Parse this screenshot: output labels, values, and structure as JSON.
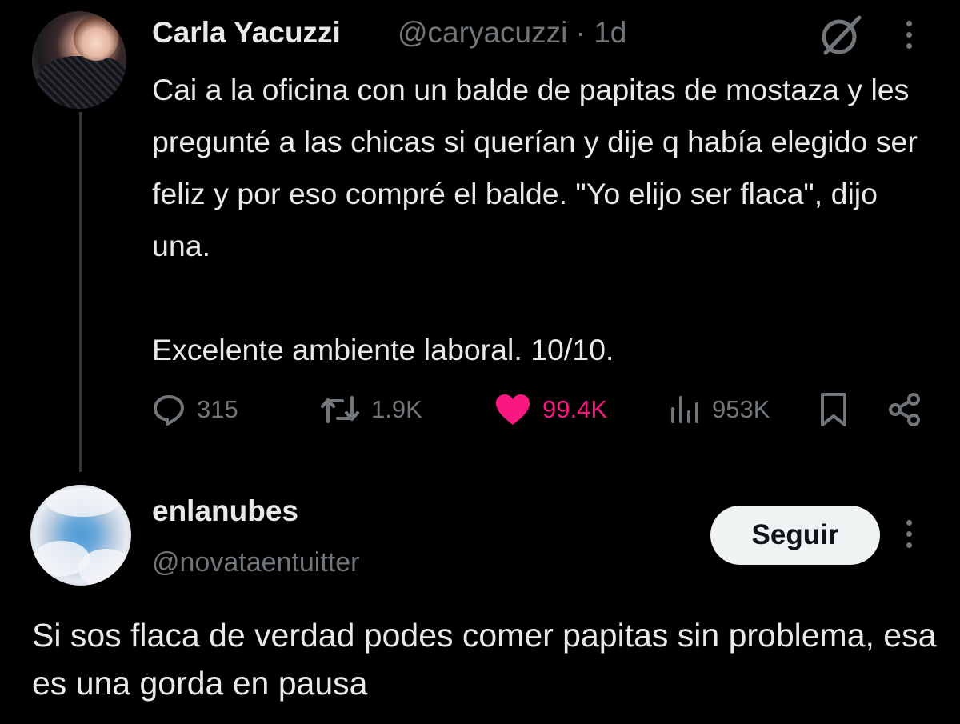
{
  "colors": {
    "background": "#000000",
    "primary_text": "#e7e9ea",
    "secondary_text": "#71767b",
    "like_pink": "#f91880",
    "follow_button_bg": "#eff3f4",
    "thread_line": "#333639"
  },
  "tweet": {
    "author_name": "Carla Yacuzzi",
    "handle_time": "@caryacuzzi · 1d",
    "text": "Cai a la oficina con un balde de papitas de mostaza y les pregunté a las chicas si querían y dije q había elegido ser feliz y por eso compré el balde. \"Yo elijo ser flaca\", dijo una.\n\nExcelente ambiente laboral. 10/10.",
    "icons": [
      "grok-icon",
      "more-icon"
    ],
    "actions": {
      "replies": "315",
      "reposts": "1.9K",
      "likes": "99.4K",
      "views": "953K",
      "liked": true
    }
  },
  "reply": {
    "author_name": "enlanubes",
    "handle": "@novataentuitter",
    "follow_label": "Seguir",
    "text": "Si sos flaca de verdad podes comer papitas sin problema, esa es una gorda en pausa"
  }
}
